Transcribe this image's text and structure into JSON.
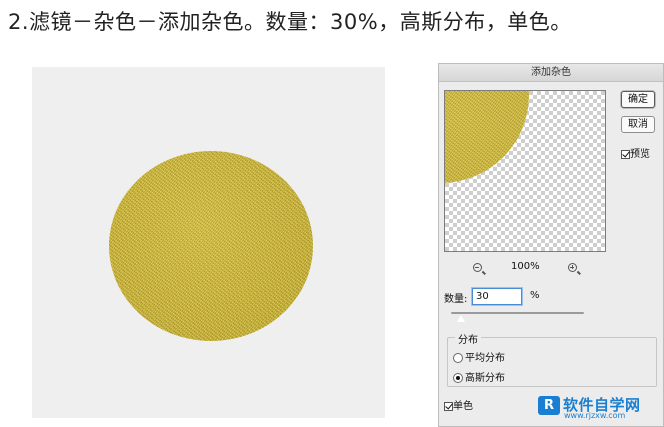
{
  "instruction": "2.滤镜－杂色－添加杂色。数量：30%，高斯分布，单色。",
  "dialog": {
    "title": "添加杂色",
    "ok_label": "确定",
    "cancel_label": "取消",
    "preview_label": "预览",
    "preview_checked": true,
    "zoom_level": "100%",
    "amount_label": "数量:",
    "amount_value": "30",
    "amount_unit": "%",
    "distribution_title": "分布",
    "uniform_label": "平均分布",
    "gaussian_label": "高斯分布",
    "selected_distribution": "gaussian",
    "monochromatic_label": "单色",
    "monochromatic_checked": true
  },
  "watermark": {
    "logo_text": "R",
    "text": "软件自学网",
    "url": "www.rjzxw.com"
  },
  "colors": {
    "noise_yellow": "#c8b33e",
    "canvas_bg": "#efefef",
    "dialog_bg": "#ececec",
    "watermark_blue": "#1a7fd0"
  },
  "icons": [
    "zoom-out-icon",
    "zoom-in-icon",
    "checkbox-icon",
    "radio-icon",
    "slider-thumb-icon"
  ]
}
